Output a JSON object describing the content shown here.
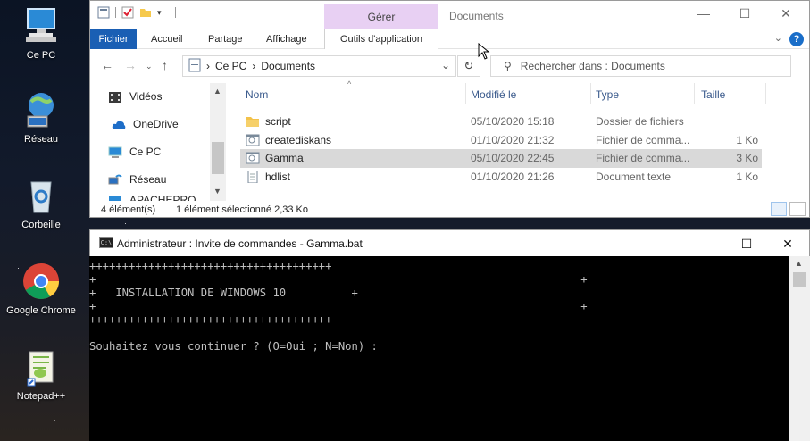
{
  "desktop": {
    "icons": [
      {
        "label": "Ce PC",
        "icon": "computer-icon"
      },
      {
        "label": "Réseau",
        "icon": "network-globe-icon"
      },
      {
        "label": "Corbeille",
        "icon": "recycle-bin-icon"
      },
      {
        "label": "Google Chrome",
        "icon": "chrome-icon"
      },
      {
        "label": "Notepad++",
        "icon": "notepad-plus-plus-icon"
      }
    ]
  },
  "explorer": {
    "window_title": "Documents",
    "contextual_tab_group": "Gérer",
    "window_controls": {
      "minimize": "—",
      "maximize": "☐",
      "close": "✕"
    },
    "ribbon": {
      "tabs": [
        "Fichier",
        "Accueil",
        "Partage",
        "Affichage",
        "Outils d'application"
      ],
      "help": "?"
    },
    "address": {
      "segments": [
        "Ce PC",
        "Documents"
      ],
      "separator": "›",
      "search_placeholder": "Rechercher dans : Documents"
    },
    "nav_pane": {
      "items": [
        {
          "label": "Vidéos",
          "icon": "videos-folder-icon"
        },
        {
          "label": "OneDrive",
          "icon": "onedrive-cloud-icon"
        },
        {
          "label": "Ce PC",
          "icon": "computer-icon"
        },
        {
          "label": "Réseau",
          "icon": "network-icon"
        },
        {
          "label": "APACHEPRO",
          "icon": "network-computer-icon"
        }
      ]
    },
    "columns": [
      "Nom",
      "Modifié le",
      "Type",
      "Taille"
    ],
    "files": [
      {
        "name": "script",
        "modified": "05/10/2020 15:18",
        "type": "Dossier de fichiers",
        "size": "",
        "icon": "folder-icon",
        "selected": false
      },
      {
        "name": "creatediskans",
        "modified": "01/10/2020 21:32",
        "type": "Fichier de comma...",
        "size": "1 Ko",
        "icon": "batch-file-icon",
        "selected": false
      },
      {
        "name": "Gamma",
        "modified": "05/10/2020 22:45",
        "type": "Fichier de comma...",
        "size": "3 Ko",
        "icon": "batch-file-icon",
        "selected": true
      },
      {
        "name": "hdlist",
        "modified": "01/10/2020 21:26",
        "type": "Document texte",
        "size": "1 Ko",
        "icon": "text-document-icon",
        "selected": false
      }
    ],
    "status": {
      "count": "4 élément(s)",
      "selection": "1 élément sélectionné 2,33 Ko"
    }
  },
  "cmd": {
    "title": "Administrateur : Invite de commandes - Gamma.bat",
    "icon_text": "C:\\",
    "window_controls": {
      "minimize": "—",
      "maximize": "☐",
      "close": "✕"
    },
    "lines": [
      "+++++++++++++++++++++++++++++++++++++",
      "+                                                                          +",
      "+   INSTALLATION DE WINDOWS 10          +",
      "+                                                                          +",
      "+++++++++++++++++++++++++++++++++++++",
      "",
      "Souhaitez vous continuer ? (O=Oui ; N=Non) :"
    ]
  }
}
